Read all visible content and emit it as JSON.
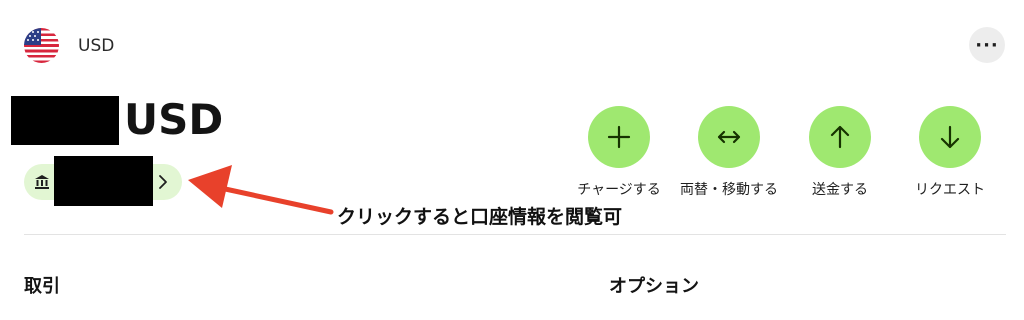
{
  "header": {
    "currency_code": "USD",
    "more_label": "···"
  },
  "balance": {
    "currency": "USD"
  },
  "actions": [
    {
      "label": "チャージする",
      "icon": "plus-icon"
    },
    {
      "label": "両替・移動する",
      "icon": "swap-arrows-icon"
    },
    {
      "label": "送金する",
      "icon": "arrow-up-icon"
    },
    {
      "label": "リクエスト",
      "icon": "arrow-down-icon"
    }
  ],
  "annotation": {
    "text": "クリックすると口座情報を閲覧可"
  },
  "sections": {
    "left": "取引",
    "right": "オプション"
  },
  "colors": {
    "accent_green": "#9fe870",
    "chip_green": "#e2f6d3",
    "arrow_red": "#e8412b"
  }
}
